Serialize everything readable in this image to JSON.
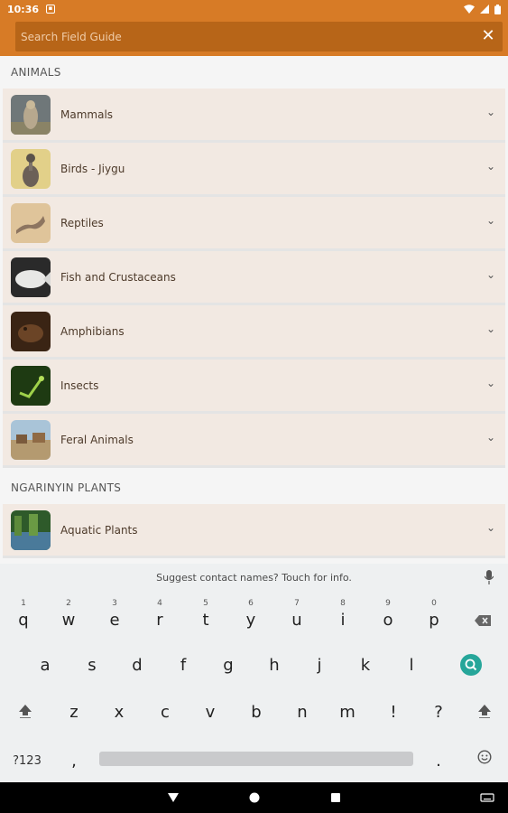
{
  "status_bar": {
    "time": "10:36",
    "notification_icon": "notification-box-icon",
    "icons": [
      "wifi-icon",
      "signal-icon",
      "battery-icon"
    ]
  },
  "search": {
    "placeholder": "Search Field Guide",
    "value": "",
    "close_icon": "close-icon"
  },
  "colors": {
    "accent": "#d77b26",
    "search_bg": "#b76518",
    "row_bg": "#f2e9e2",
    "keyboard_bg": "#eef0f1",
    "search_key": "#26a69a"
  },
  "sections": [
    {
      "title": "ANIMALS",
      "items": [
        {
          "label": "Mammals",
          "thumb": "mammals-thumbnail"
        },
        {
          "label": "Birds - Jiygu",
          "thumb": "birds-thumbnail"
        },
        {
          "label": "Reptiles",
          "thumb": "reptiles-thumbnail"
        },
        {
          "label": "Fish and Crustaceans",
          "thumb": "fish-thumbnail"
        },
        {
          "label": "Amphibians",
          "thumb": "amphibians-thumbnail"
        },
        {
          "label": "Insects",
          "thumb": "insects-thumbnail"
        },
        {
          "label": "Feral Animals",
          "thumb": "feral-animals-thumbnail"
        }
      ]
    },
    {
      "title": "NGARINYIN PLANTS",
      "items": [
        {
          "label": "Aquatic Plants",
          "thumb": "aquatic-plants-thumbnail"
        }
      ]
    }
  ],
  "keyboard": {
    "suggestion": "Suggest contact names? Touch for info.",
    "row1": [
      {
        "k": "q",
        "h": "1"
      },
      {
        "k": "w",
        "h": "2"
      },
      {
        "k": "e",
        "h": "3"
      },
      {
        "k": "r",
        "h": "4"
      },
      {
        "k": "t",
        "h": "5"
      },
      {
        "k": "y",
        "h": "6"
      },
      {
        "k": "u",
        "h": "7"
      },
      {
        "k": "i",
        "h": "8"
      },
      {
        "k": "o",
        "h": "9"
      },
      {
        "k": "p",
        "h": "0"
      }
    ],
    "row2": [
      "a",
      "s",
      "d",
      "f",
      "g",
      "h",
      "j",
      "k",
      "l"
    ],
    "row3": [
      "z",
      "x",
      "c",
      "v",
      "b",
      "n",
      "m",
      "!",
      "?"
    ],
    "symbols_label": "?123",
    "comma": ",",
    "period": ".",
    "icons": [
      "backspace-icon",
      "search-key-icon",
      "shift-icon",
      "emoji-icon",
      "mic-icon"
    ]
  },
  "nav_bar": {
    "icons": [
      "back-icon",
      "home-icon",
      "recents-icon",
      "keyboard-switch-icon"
    ]
  }
}
